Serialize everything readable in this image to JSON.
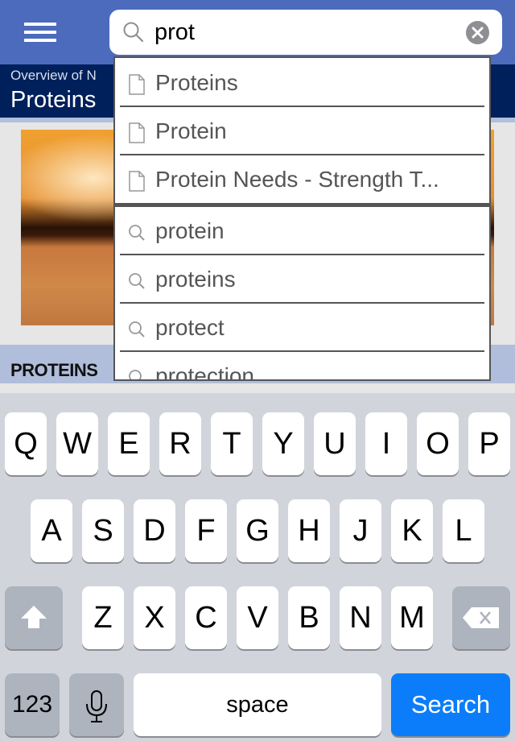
{
  "header": {
    "menu_icon": "hamburger-menu-icon",
    "search": {
      "value": "prot",
      "placeholder": "",
      "icon": "search-icon",
      "clear_icon": "clear-circle-icon"
    }
  },
  "title_bar": {
    "breadcrumb": "Overview of N",
    "title": "Proteins"
  },
  "content": {
    "section_title": "PROTEINS"
  },
  "autocomplete": {
    "documents": [
      {
        "label": "Proteins",
        "icon": "document-icon"
      },
      {
        "label": "Protein",
        "icon": "document-icon"
      },
      {
        "label": "Protein Needs - Strength T...",
        "icon": "document-icon"
      }
    ],
    "queries": [
      {
        "label": "protein",
        "icon": "search-icon"
      },
      {
        "label": "proteins",
        "icon": "search-icon"
      },
      {
        "label": "protect",
        "icon": "search-icon"
      },
      {
        "label": "protection",
        "icon": "search-icon"
      }
    ]
  },
  "keyboard": {
    "row1": [
      "Q",
      "W",
      "E",
      "R",
      "T",
      "Y",
      "U",
      "I",
      "O",
      "P"
    ],
    "row2": [
      "A",
      "S",
      "D",
      "F",
      "G",
      "H",
      "J",
      "K",
      "L"
    ],
    "row3": [
      "Z",
      "X",
      "C",
      "V",
      "B",
      "N",
      "M"
    ],
    "shift_icon": "shift-arrow-icon",
    "backspace_icon": "backspace-icon",
    "numbers_label": "123",
    "mic_icon": "microphone-icon",
    "space_label": "space",
    "search_label": "Search"
  },
  "colors": {
    "navbar": "#4c6bbd",
    "title_bar": "#00205b",
    "section_header": "#b0bedb",
    "search_key": "#0c7dfa"
  }
}
